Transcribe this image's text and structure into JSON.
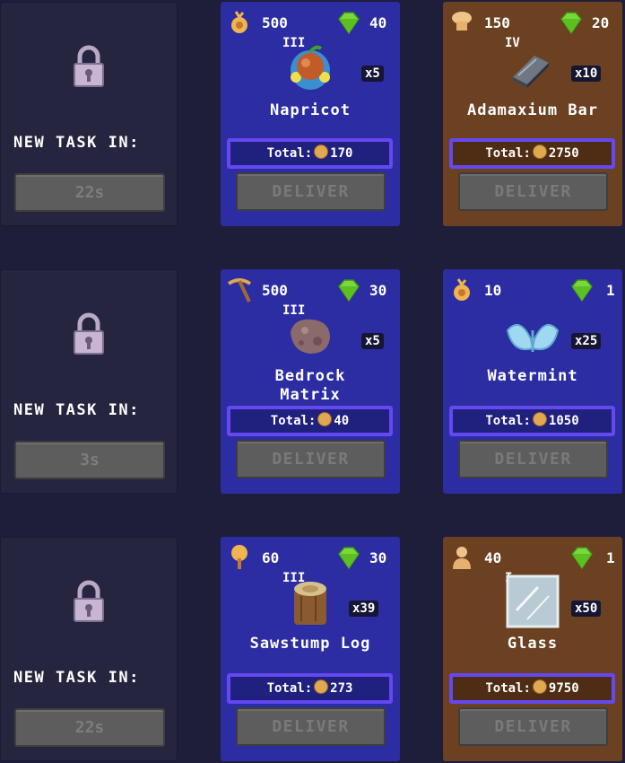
{
  "locked": [
    {
      "label": "NEW TASK IN:",
      "timer": "22s"
    },
    {
      "label": "NEW TASK IN:",
      "timer": "3s"
    },
    {
      "label": "NEW TASK IN:",
      "timer": "22s"
    }
  ],
  "tasks": [
    {
      "skill_icon": "harvest-icon",
      "skill_value": "500",
      "gem_value": "40",
      "tier": "III",
      "name": "Napricot",
      "qty": "x5",
      "total_label": "Total:",
      "total": "170",
      "deliver": "DELIVER"
    },
    {
      "skill_icon": "chef-icon",
      "skill_value": "150",
      "gem_value": "20",
      "tier": "IV",
      "name": "Adamaxium Bar",
      "qty": "x10",
      "total_label": "Total:",
      "total": "2750",
      "deliver": "DELIVER"
    },
    {
      "skill_icon": "pickaxe-icon",
      "skill_value": "500",
      "gem_value": "30",
      "tier": "III",
      "name": "Bedrock Matrix",
      "qty": "x5",
      "total_label": "Total:",
      "total": "40",
      "deliver": "DELIVER"
    },
    {
      "skill_icon": "harvest-icon",
      "skill_value": "10",
      "gem_value": "1",
      "tier": "",
      "name": "Watermint",
      "qty": "x25",
      "total_label": "Total:",
      "total": "1050",
      "deliver": "DELIVER"
    },
    {
      "skill_icon": "tree-icon",
      "skill_value": "60",
      "gem_value": "30",
      "tier": "III",
      "name": "Sawstump Log",
      "qty": "x39",
      "total_label": "Total:",
      "total": "273",
      "deliver": "DELIVER"
    },
    {
      "skill_icon": "bust-icon",
      "skill_value": "40",
      "gem_value": "1",
      "tier": "I",
      "name": "Glass",
      "qty": "x50",
      "total_label": "Total:",
      "total": "9750",
      "deliver": "DELIVER"
    }
  ],
  "colors": {
    "blue_card": "#2c2ca3",
    "brown_card": "#6b4121",
    "total_border": "#6448f0",
    "background": "#1e1d3a"
  }
}
